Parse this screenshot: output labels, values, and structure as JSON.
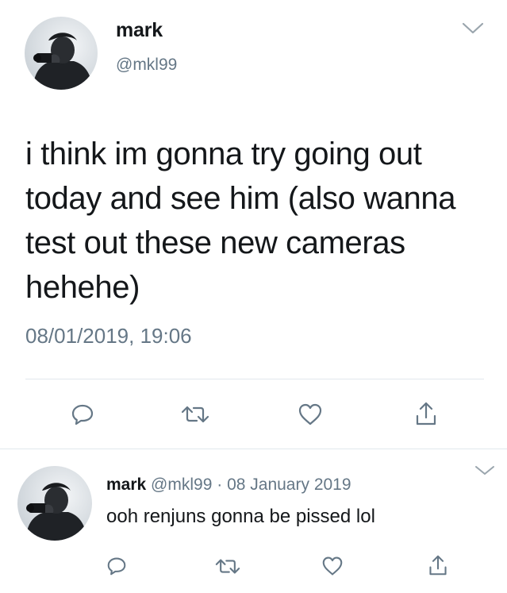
{
  "main_tweet": {
    "name": "mark",
    "handle": "@mkl99",
    "text": "i think im gonna try going out today and see him (also wanna test out these new cameras hehehe)",
    "timestamp": "08/01/2019, 19:06",
    "actions": [
      {
        "icon": "reply-icon"
      },
      {
        "icon": "retweet-icon"
      },
      {
        "icon": "like-icon"
      },
      {
        "icon": "share-icon"
      }
    ]
  },
  "reply_tweet": {
    "name": "mark",
    "handle": "@mkl99",
    "separator": "·",
    "date": "08 January 2019",
    "text": "ooh renjuns gonna be pissed lol",
    "actions": [
      {
        "icon": "reply-icon"
      },
      {
        "icon": "retweet-icon"
      },
      {
        "icon": "like-icon"
      },
      {
        "icon": "share-icon"
      }
    ]
  },
  "colors": {
    "text": "#14171a",
    "secondary": "#657786",
    "divider": "#e1e8ed",
    "icon": "#657786"
  }
}
